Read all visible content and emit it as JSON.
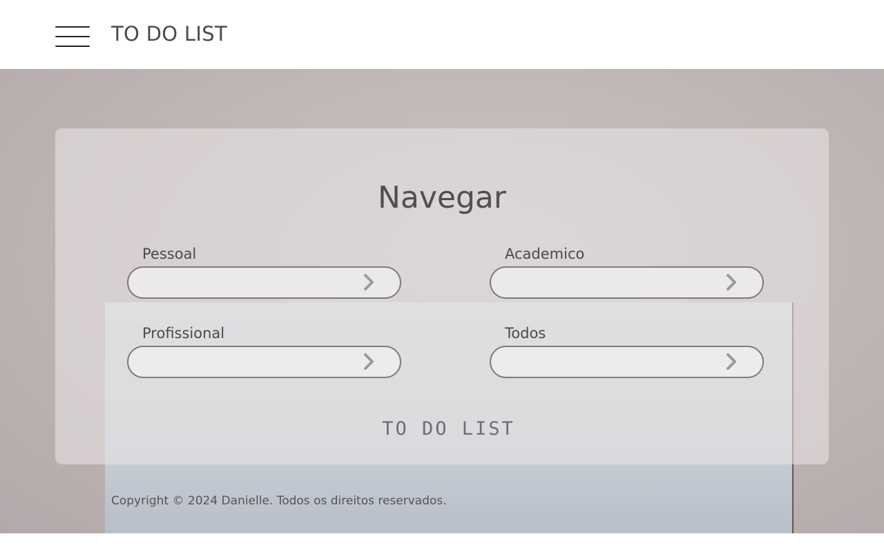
{
  "header": {
    "brand": "TO DO LIST",
    "menu_icon": "hamburger-menu-icon"
  },
  "panel": {
    "title": "Navegar",
    "categories": [
      {
        "label": "Pessoal",
        "icon": "chevron-right-icon"
      },
      {
        "label": "Academico",
        "icon": "chevron-right-icon"
      },
      {
        "label": "Profissional",
        "icon": "chevron-right-icon"
      },
      {
        "label": "Todos",
        "icon": "chevron-right-icon"
      }
    ],
    "footer_brand": "TO DO LIST"
  },
  "footer": {
    "copyright": "Copyright © 2024 Danielle. Todos os direitos reservados."
  },
  "colors": {
    "background": "#bfb5b5",
    "panel": "#e8e4e3",
    "text": "#4a4a4a",
    "field_border": "#7e7b7a"
  }
}
